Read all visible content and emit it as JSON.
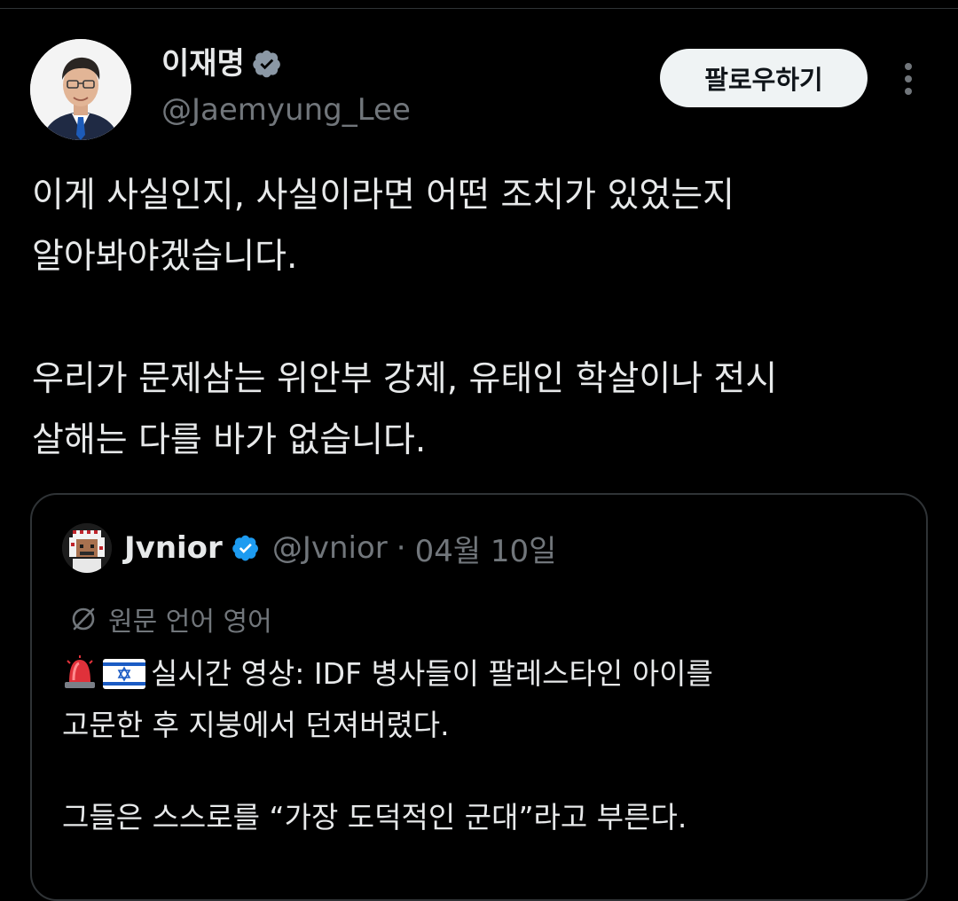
{
  "author": {
    "name": "이재명",
    "handle": "@Jaemyung_Lee",
    "verified": true,
    "avatar_icon": "profile-photo"
  },
  "actions": {
    "follow_label": "팔로우하기",
    "more_icon": "vertical-ellipsis-icon"
  },
  "tweet": {
    "paragraphs": [
      [
        "이게 사실인지, 사실이라면 어떤 조치가 있었는지",
        "알아봐야겠습니다."
      ],
      [
        "우리가 문제삼는 위안부 강제, 유태인 학살이나 전시",
        "살해는 다를 바가 없습니다."
      ]
    ]
  },
  "quote": {
    "name": "Jvnior",
    "handle": "@Jvnior",
    "separator": "·",
    "date": "04월 10일",
    "verified": true,
    "translate_label": "원문 언어 영어",
    "emoji": [
      "police-light-emoji",
      "israel-flag-emoji"
    ],
    "lines": [
      "실시간 영상: IDF 병사들이 팔레스타인 아이를",
      "고문한 후 지붕에서 던져버렸다.",
      "",
      "그들은 스스로를 “가장 도덕적인 군대”라고 부른다."
    ]
  },
  "colors": {
    "background": "#000000",
    "text": "#e7e9ea",
    "secondary": "#71767b",
    "verified_blue": "#1d9bf0",
    "border": "#2f3336",
    "button_bg": "#eff3f4"
  }
}
